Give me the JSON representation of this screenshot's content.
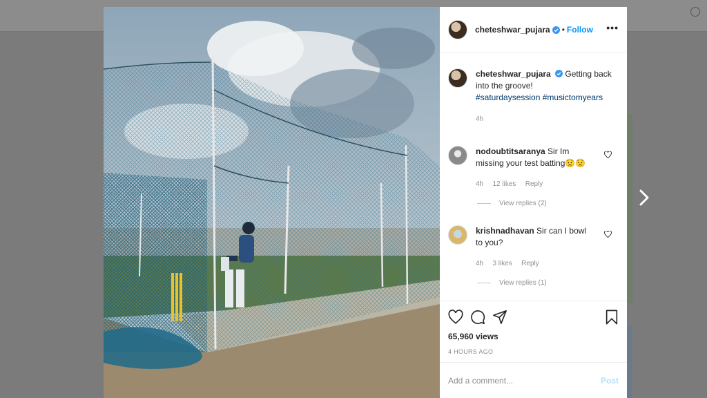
{
  "post": {
    "username": "cheteshwar_pujara",
    "follow_label": "Follow",
    "more_label": "•••",
    "caption_username": "cheteshwar_pujara",
    "caption_text": "Getting back into the groove!",
    "caption_hashtags": "#saturdaysession #musictomyears",
    "caption_time": "4h",
    "views": "65,960 views",
    "time_ago": "4 HOURS AGO"
  },
  "comments": [
    {
      "username": "nodoubtitsaranya",
      "text": "Sir Im missing your test batting😟😟",
      "time": "4h",
      "likes": "12 likes",
      "reply_label": "Reply",
      "view_replies": "View replies (2)"
    },
    {
      "username": "krishnadhavan",
      "text": "Sir can I bowl to you?",
      "time": "4h",
      "likes": "3 likes",
      "reply_label": "Reply",
      "view_replies": "View replies (1)"
    }
  ],
  "add_comment": {
    "placeholder": "Add a comment...",
    "post_label": "Post"
  },
  "icons": {
    "like": "heart-icon",
    "comment": "comment-icon",
    "share": "share-icon",
    "save": "bookmark-icon",
    "next": "chevron-right-icon",
    "verified": "verified-badge-icon"
  },
  "colors": {
    "accent": "#0095f6",
    "post_disabled": "#b2dffc",
    "muted": "#8e8e8e",
    "hashtag": "#00376b"
  }
}
